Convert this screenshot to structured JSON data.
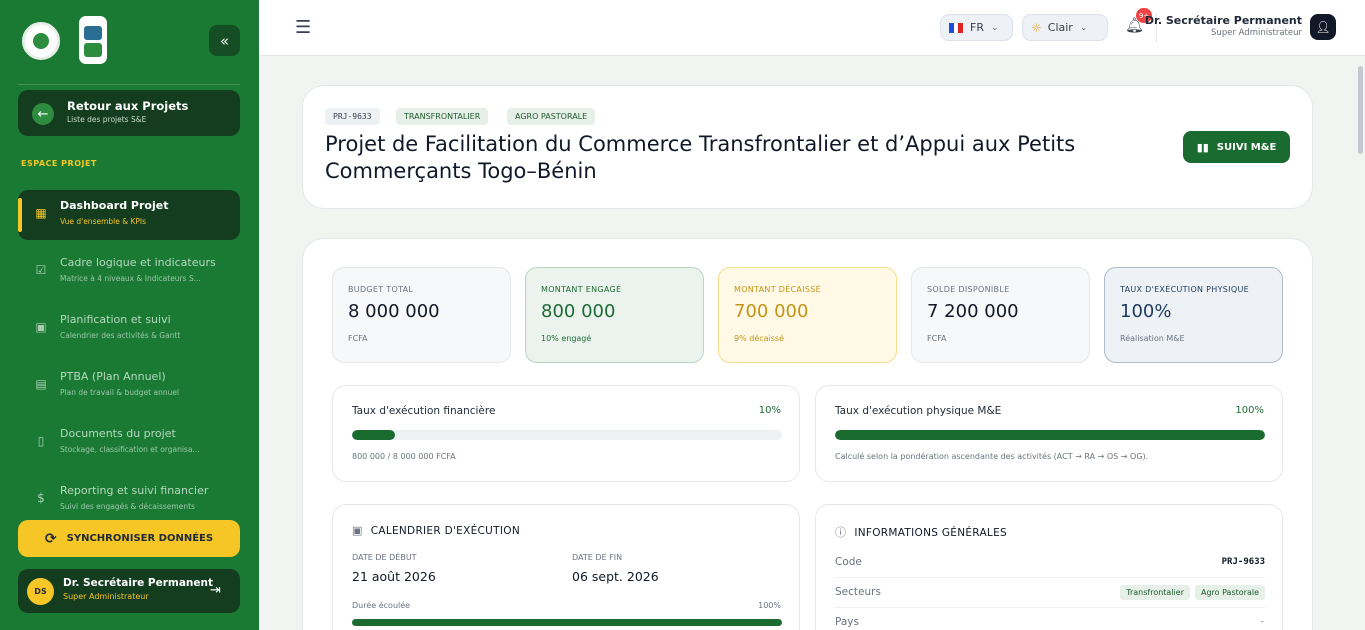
{
  "sidebar": {
    "back": {
      "title": "Retour aux Projets",
      "subtitle": "Liste des projets S&E"
    },
    "section_label": "ESPACE PROJET",
    "items": [
      {
        "label": "Dashboard Projet",
        "sub": "Vue d'ensemble & KPIs",
        "icon": "grid-icon"
      },
      {
        "label": "Cadre logique et indicateurs",
        "sub": "Matrice à 4 niveaux & Indicateurs S...",
        "icon": "clipboard-check-icon"
      },
      {
        "label": "Planification et suivi",
        "sub": "Calendrier des activités & Gantt",
        "icon": "calendar-icon"
      },
      {
        "label": "PTBA (Plan Annuel)",
        "sub": "Plan de travail & budget annuel",
        "icon": "report-icon"
      },
      {
        "label": "Documents du projet",
        "sub": "Stockage, classification et organisa...",
        "icon": "document-icon"
      },
      {
        "label": "Reporting et suivi financier",
        "sub": "Suivi des engagés & décaissements",
        "icon": "dollar-icon"
      }
    ],
    "sync_label": "SYNCHRONISER DONNÉES",
    "user": {
      "initials": "DS",
      "name": "Dr. Secrétaire Permanent",
      "role": "Super Administrateur"
    }
  },
  "topbar": {
    "language": "FR",
    "theme": "Clair",
    "notif_count": "9+",
    "user_name": "Dr. Secrétaire Permanent",
    "user_role": "Super Administrateur"
  },
  "project": {
    "code": "PRJ-9633",
    "tags": [
      "TRANSFRONTALIER",
      "AGRO PASTORALE"
    ],
    "title": "Projet de Facilitation du Commerce Transfrontalier et d’Appui aux Petits Commerçants Togo–Bénin",
    "suivi_label": "SUIVI M&E"
  },
  "kpis": [
    {
      "label": "BUDGET TOTAL",
      "value": "8 000 000",
      "sub": "FCFA"
    },
    {
      "label": "MONTANT ENGAGÉ",
      "value": "800 000",
      "sub": "10% engagé"
    },
    {
      "label": "MONTANT DÉCAISSÉ",
      "value": "700 000",
      "sub": "9% décaissé"
    },
    {
      "label": "SOLDE DISPONIBLE",
      "value": "7 200 000",
      "sub": "FCFA"
    },
    {
      "label": "TAUX D'EXÉCUTION PHYSIQUE",
      "value": "100%",
      "sub": "Réalisation M&E"
    }
  ],
  "progress": [
    {
      "title": "Taux d'exécution financière",
      "percent_label": "10%",
      "fraction": 0.1,
      "note": "800 000 / 8 000 000 FCFA"
    },
    {
      "title": "Taux d'exécution physique M&E",
      "percent_label": "100%",
      "fraction": 1.0,
      "note": "Calculé selon la pondération ascendante des activités (ACT → RA → OS → OG)."
    }
  ],
  "calendar": {
    "title": "CALENDRIER D'EXÉCUTION",
    "start_label": "DATE DE DÉBUT",
    "start_value": "21 août 2026",
    "end_label": "DATE DE FIN",
    "end_value": "06 sept. 2026",
    "duration_label": "Durée écoulée",
    "duration_percent": "100%",
    "duration_fraction": 1.0
  },
  "info": {
    "title": "INFORMATIONS GÉNÉRALES",
    "code_label": "Code",
    "code_value": "PRJ-9633",
    "sectors_label": "Secteurs",
    "sectors": [
      "Transfrontalier",
      "Agro Pastorale"
    ],
    "country_label": "Pays",
    "country_value": "-"
  },
  "colors": {
    "sidebar": "#1a7a33",
    "accent": "#f6c626",
    "primary": "#1a6b30"
  }
}
